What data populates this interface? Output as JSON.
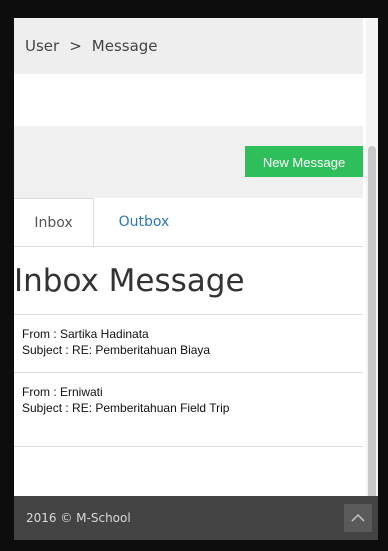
{
  "breadcrumb": {
    "root": "User",
    "separator": ">",
    "current": "Message"
  },
  "toolbar": {
    "new_message_label": "New Message"
  },
  "tabs": [
    {
      "label": "Inbox",
      "active": true
    },
    {
      "label": "Outbox",
      "active": false
    }
  ],
  "page_title": "Inbox Message",
  "messages": [
    {
      "from": "From : Sartika Hadinata",
      "subject": "Subject : RE: Pemberitahuan Biaya"
    },
    {
      "from": "From : Erniwati",
      "subject": "Subject : RE: Pemberitahuan Field Trip"
    }
  ],
  "footer": {
    "copyright": "2016 © M-School",
    "to_top_icon": "chevron-up-icon"
  },
  "colors": {
    "accent_green": "#2fbf5a",
    "link_blue": "#2a78b8",
    "footer_bg": "#444444"
  }
}
